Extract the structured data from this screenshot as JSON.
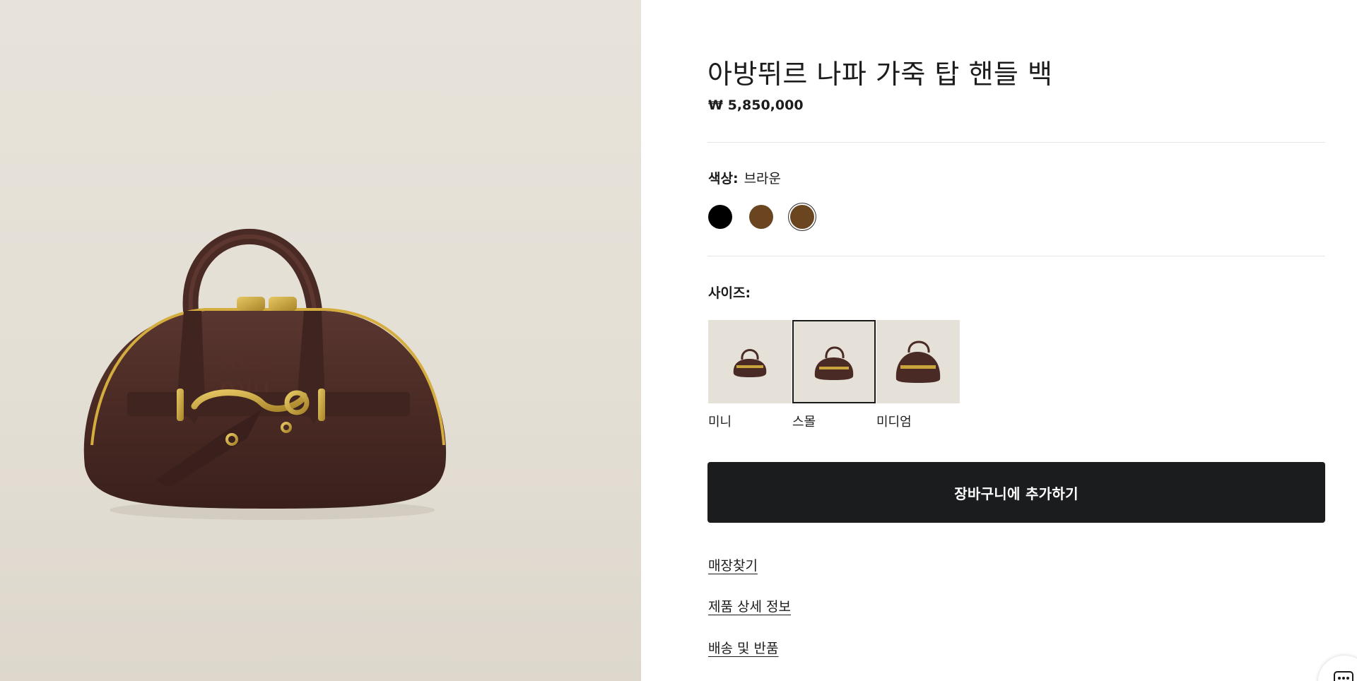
{
  "product": {
    "title": "아방뛰르 나파 가죽 탑 핸들 백",
    "price": "₩ 5,850,000",
    "image_icon": "brown-leather-top-handle-bag"
  },
  "color": {
    "label": "색상:",
    "selected_value": "브라운",
    "swatches": [
      {
        "name": "black",
        "hex": "#000000"
      },
      {
        "name": "brown",
        "hex": "#6b4520"
      },
      {
        "name": "brown-selected",
        "hex": "#6b4520"
      }
    ]
  },
  "size": {
    "label": "사이즈:",
    "options": [
      {
        "label": "미니",
        "selected": false
      },
      {
        "label": "스몰",
        "selected": true
      },
      {
        "label": "미디엄",
        "selected": false
      }
    ]
  },
  "cta": {
    "add_to_cart": "장바구니에 추가하기"
  },
  "links": {
    "find_store": "매장찾기",
    "product_details": "제품 상세 정보",
    "shipping_returns": "배송 및 반품"
  },
  "colors": {
    "button_bg": "#1b1c1e",
    "image_bg": "#e4dfd5",
    "bag_leather": "#4a2a24",
    "hardware_gold": "#c9a43c"
  },
  "chat": {
    "icon": "chat-icon"
  }
}
